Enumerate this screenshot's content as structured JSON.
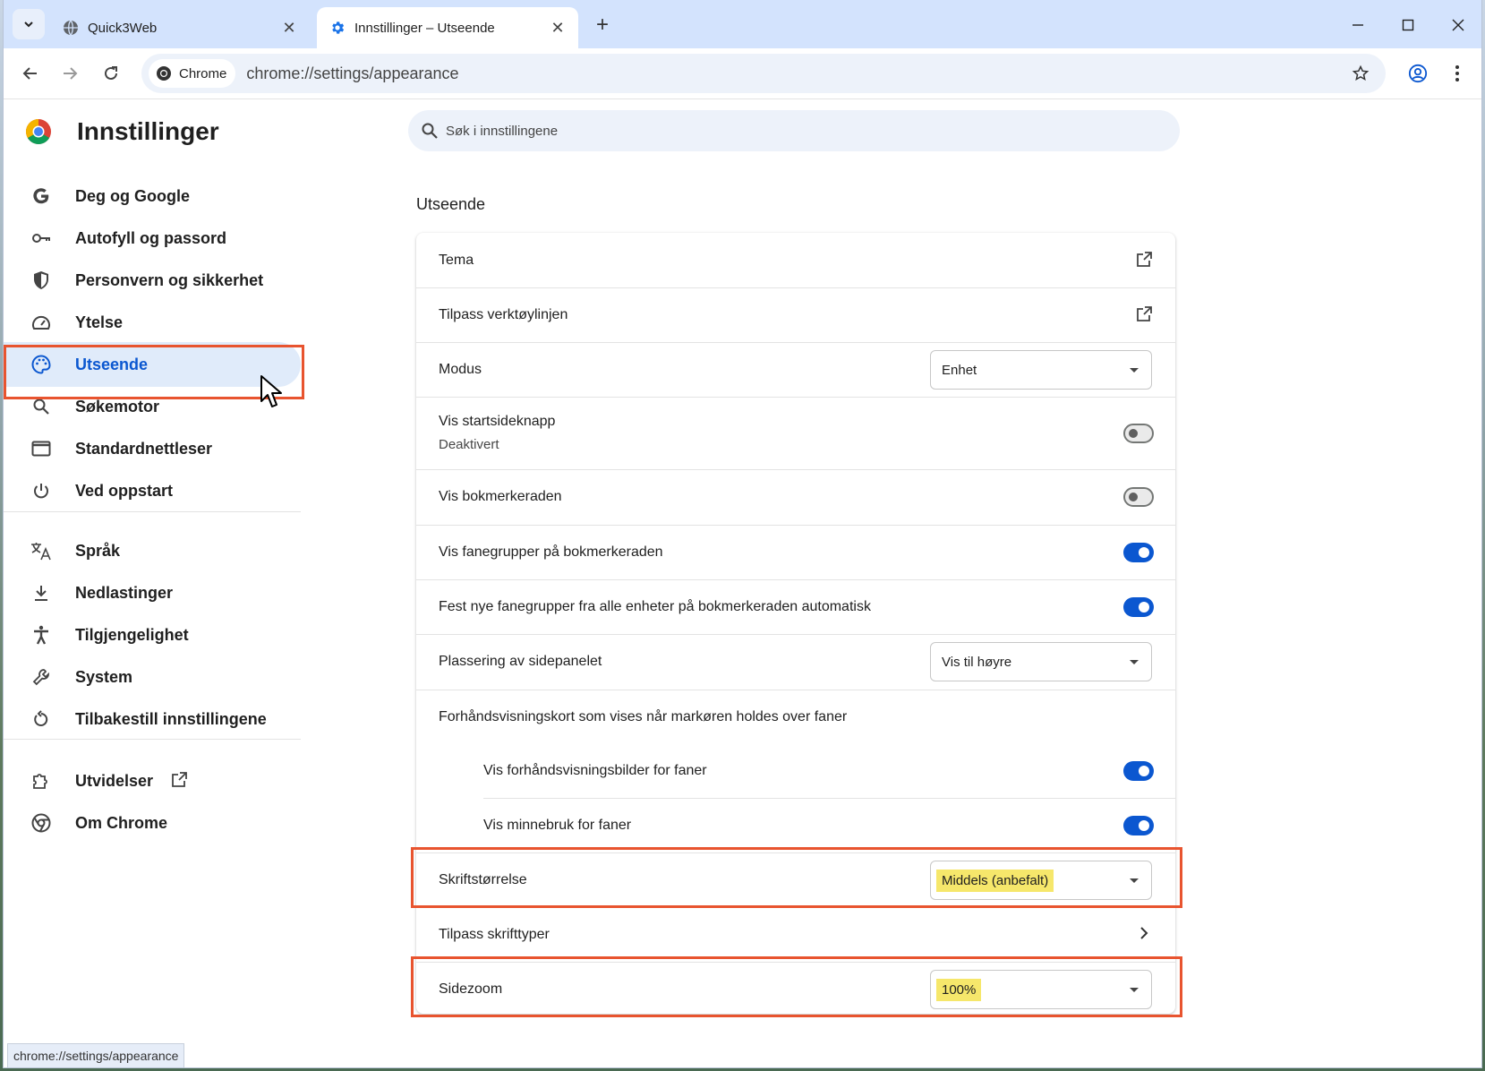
{
  "tabs": {
    "inactive": {
      "title": "Quick3Web"
    },
    "active": {
      "title": "Innstillinger – Utseende"
    }
  },
  "toolbar": {
    "chip_label": "Chrome",
    "url": "chrome://settings/appearance"
  },
  "sidebar": {
    "title": "Innstillinger",
    "items": [
      {
        "label": "Deg og Google",
        "icon": "google-g-icon"
      },
      {
        "label": "Autofyll og passord",
        "icon": "key-icon"
      },
      {
        "label": "Personvern og sikkerhet",
        "icon": "shield-icon"
      },
      {
        "label": "Ytelse",
        "icon": "speedometer-icon"
      },
      {
        "label": "Utseende",
        "icon": "palette-icon",
        "active": true
      },
      {
        "label": "Søkemotor",
        "icon": "search-icon"
      },
      {
        "label": "Standardnettleser",
        "icon": "browser-window-icon"
      },
      {
        "label": "Ved oppstart",
        "icon": "power-icon"
      },
      {
        "label": "Språk",
        "icon": "translate-icon"
      },
      {
        "label": "Nedlastinger",
        "icon": "download-icon"
      },
      {
        "label": "Tilgjengelighet",
        "icon": "accessibility-icon"
      },
      {
        "label": "System",
        "icon": "wrench-icon"
      },
      {
        "label": "Tilbakestill innstillingene",
        "icon": "reset-icon"
      },
      {
        "label": "Utvidelser",
        "icon": "puzzle-icon"
      },
      {
        "label": "Om Chrome",
        "icon": "chrome-icon"
      }
    ]
  },
  "search": {
    "placeholder": "Søk i innstillingene"
  },
  "section": {
    "title": "Utseende"
  },
  "settings": {
    "tema": "Tema",
    "verktoylinje": "Tilpass verktøylinjen",
    "modus": {
      "label": "Modus",
      "value": "Enhet"
    },
    "startside": {
      "label": "Vis startsideknapp",
      "sub": "Deaktivert",
      "on": false
    },
    "bokmerkeraden": {
      "label": "Vis bokmerkeraden",
      "on": false
    },
    "fanegrupper": {
      "label": "Vis fanegrupper på bokmerkeraden",
      "on": true
    },
    "fest": {
      "label": "Fest nye fanegrupper fra alle enheter på bokmerkeraden automatisk",
      "on": true
    },
    "sidepanel": {
      "label": "Plassering av sidepanelet",
      "value": "Vis til høyre"
    },
    "forhandsvisning": {
      "label": "Forhåndsvisningskort som vises når markøren holdes over faner"
    },
    "bilder": {
      "label": "Vis forhåndsvisningsbilder for faner",
      "on": true
    },
    "minnebruk": {
      "label": "Vis minnebruk for faner",
      "on": true
    },
    "skrift": {
      "label": "Skriftstørrelse",
      "value": "Middels (anbefalt)"
    },
    "skrifttyper": {
      "label": "Tilpass skrifttyper"
    },
    "zoom": {
      "label": "Sidezoom",
      "value": "100%"
    }
  },
  "statusbar": {
    "text": "chrome://settings/appearance"
  },
  "colors": {
    "accent": "#0b57d0",
    "highlight_border": "#e8542f",
    "marker": "#f6e76b"
  }
}
